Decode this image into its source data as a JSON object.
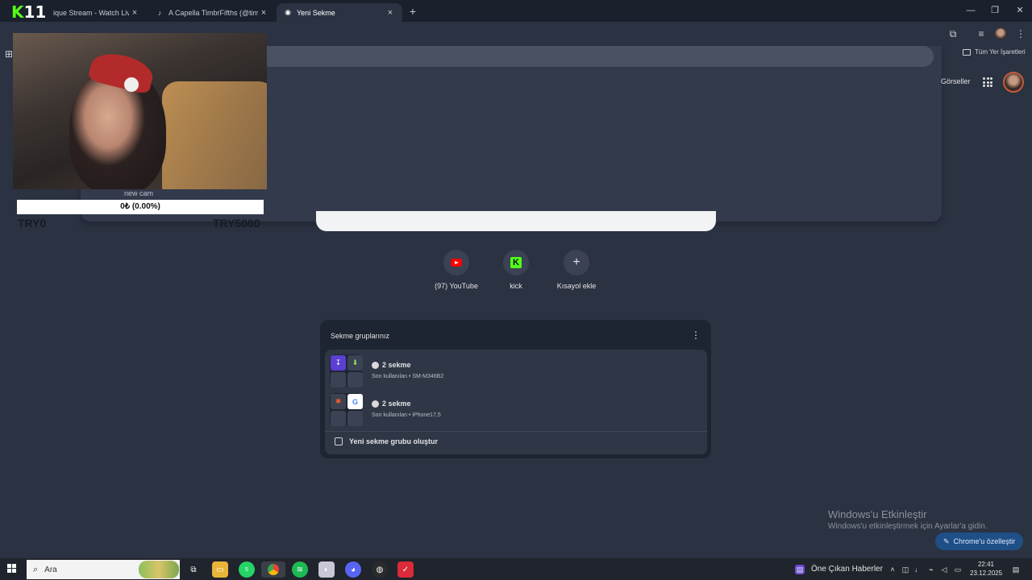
{
  "tabs": [
    {
      "title": "ique Stream - Watch Live o",
      "close": "×"
    },
    {
      "title": "A Capella TimbrFifths (@timbrf",
      "close": "×"
    },
    {
      "title": "Yeni Sekme",
      "close": "×"
    }
  ],
  "new_tab_glyph": "+",
  "window_controls": {
    "minimize": "—",
    "restore": "❐",
    "close": "✕"
  },
  "toolbar": {
    "extensions_glyph": "⧉",
    "media_glyph": "≡",
    "menu_glyph": "⋮",
    "apps_glyph": "⊞"
  },
  "bookmarks": {
    "all_bookmarks": "Tüm Yer İşaretleri"
  },
  "google": {
    "images_link": "Görseller"
  },
  "overlay": {
    "logo_k": "K",
    "logo_num": "11",
    "cam_label": "new cam",
    "donation_text": "0₺ (0.00%)",
    "goal_min": "TRY0",
    "goal_max": "TRY5000"
  },
  "shortcuts": [
    {
      "label": "(97) YouTube"
    },
    {
      "label": "kick",
      "logo": "K"
    },
    {
      "label": "Kısayol ekle",
      "glyph": "+"
    }
  ],
  "tab_groups": {
    "title": "Sekme gruplarınız",
    "menu_glyph": "⋮",
    "groups": [
      {
        "name": "2 sekme",
        "sub": "Son kullanılan • SM-M346B2"
      },
      {
        "name": "2 sekme",
        "sub": "Son kullanılan • iPhone17,5"
      }
    ],
    "create_label": "Yeni sekme grubu oluştur"
  },
  "watermark": {
    "title": "Windows'u Etkinleştir",
    "sub": "Windows'u etkinleştirmek için Ayarlar'a gidin."
  },
  "customize_chrome": {
    "glyph": "✎",
    "label": "Chrome'u özelleştir"
  },
  "taskbar": {
    "search_placeholder": "Ara",
    "news": "Öne Çıkan Haberler",
    "whatsapp_badge": "5",
    "time": "22:41",
    "date": "23.12.2025"
  },
  "colors": {
    "accent": "#53fc18",
    "background": "#2b3242",
    "youtube": "#ff0000"
  }
}
